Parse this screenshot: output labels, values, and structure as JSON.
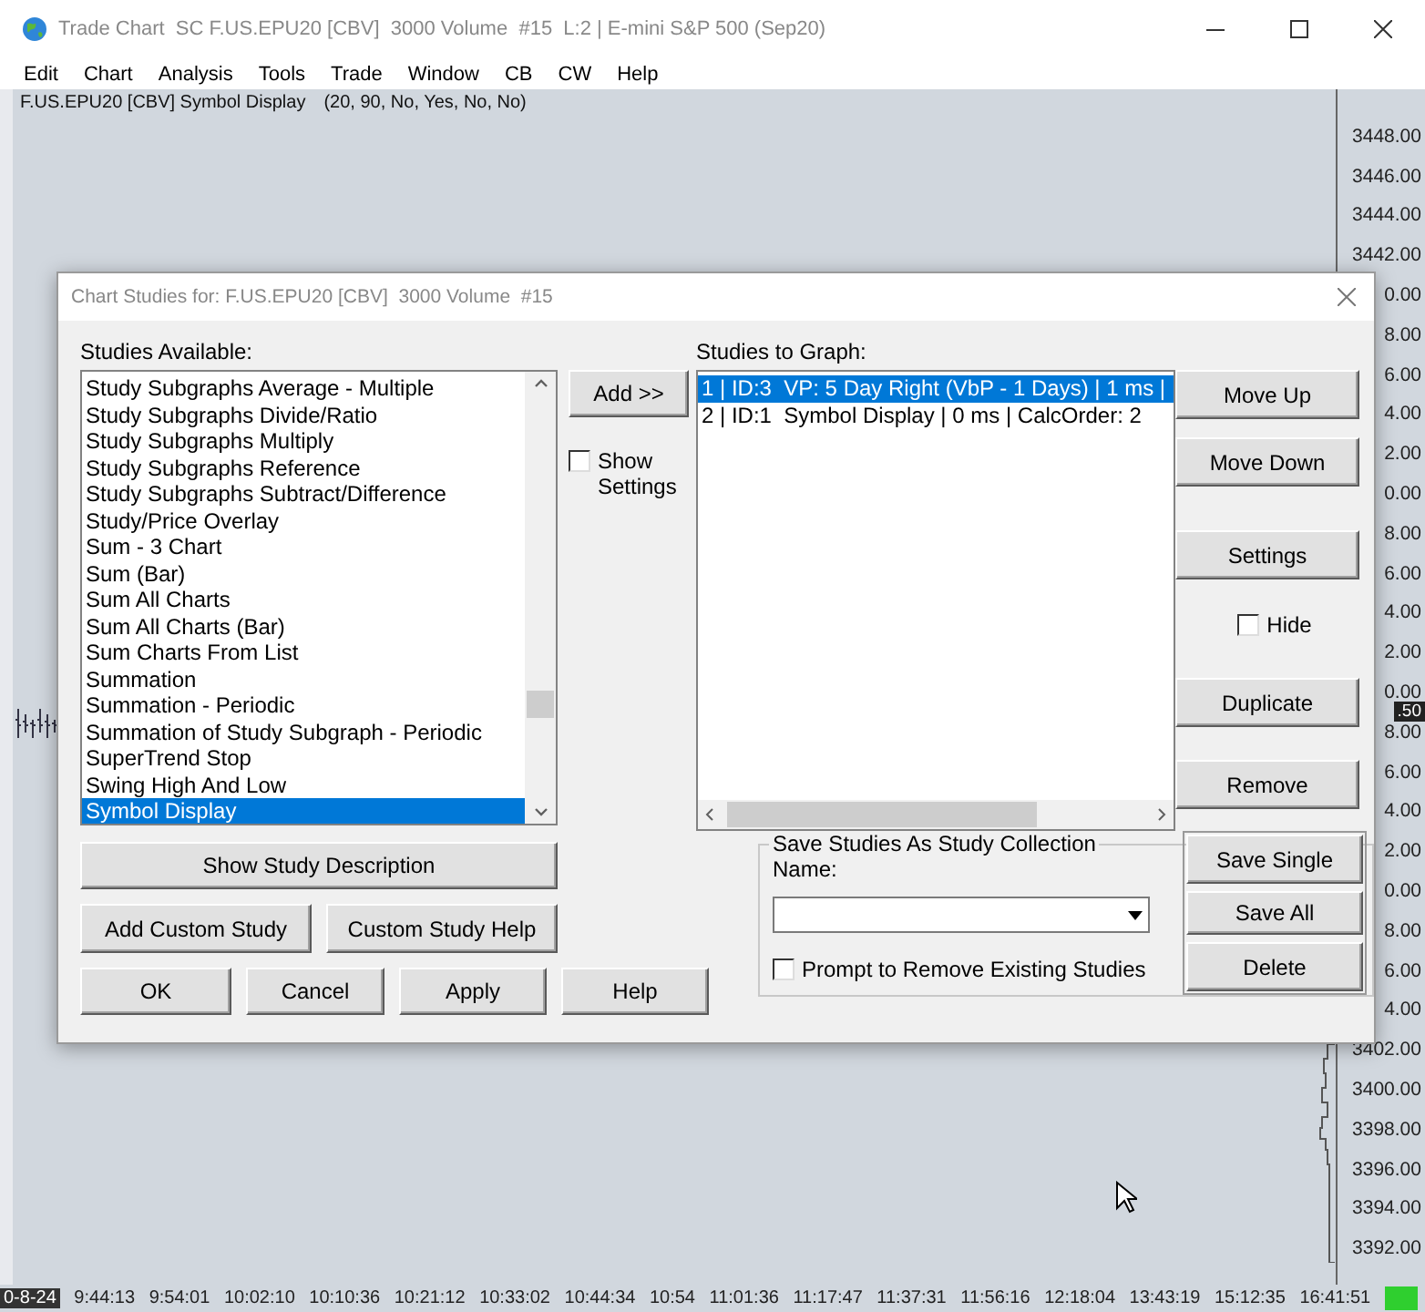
{
  "window": {
    "title": "Trade Chart  SC F.US.EPU20 [CBV]  3000 Volume  #15  L:2 | E-mini S&P 500 (Sep20)"
  },
  "menu": [
    "Edit",
    "Chart",
    "Analysis",
    "Tools",
    "Trade",
    "Window",
    "CB",
    "CW",
    "Help"
  ],
  "chart": {
    "study_label": "F.US.EPU20 [CBV] Symbol Display",
    "study_params": "(20, 90, No, Yes, No, No)",
    "price_labels": [
      "3448.00",
      "3446.00",
      "3444.00",
      "3442.00",
      "0.00",
      "8.00",
      "6.00",
      "4.00",
      "2.00",
      "0.00",
      "8.00",
      "6.00",
      "4.00",
      "2.00",
      "0.00",
      "8.00",
      "6.00",
      "4.00",
      "2.00",
      "0.00",
      "8.00",
      "6.00",
      "4.00",
      "3402.00",
      "3400.00",
      "3398.00",
      "3396.00",
      "3394.00",
      "3392.00"
    ],
    "current_price": ".50",
    "date_label": "0-8-24",
    "time_labels": [
      "9:44:13",
      "9:54:01",
      "10:02:10",
      "10:10:36",
      "10:21:12",
      "10:33:02",
      "10:44:34",
      "10:54",
      "11:01:36",
      "11:17:47",
      "11:37:31",
      "11:56:16",
      "12:18:04",
      "13:43:19",
      "15:12:35",
      "16:41:51"
    ]
  },
  "dialog": {
    "title": "Chart Studies for: F.US.EPU20 [CBV]  3000 Volume  #15",
    "available_label": "Studies Available:",
    "available": [
      {
        "label": "Study Subgraphs Average - Multiple",
        "selected": false
      },
      {
        "label": "Study Subgraphs Divide/Ratio",
        "selected": false
      },
      {
        "label": "Study Subgraphs Multiply",
        "selected": false
      },
      {
        "label": "Study Subgraphs Reference",
        "selected": false
      },
      {
        "label": "Study Subgraphs Subtract/Difference",
        "selected": false
      },
      {
        "label": "Study/Price Overlay",
        "selected": false
      },
      {
        "label": "Sum - 3 Chart",
        "selected": false
      },
      {
        "label": "Sum (Bar)",
        "selected": false
      },
      {
        "label": "Sum All Charts",
        "selected": false
      },
      {
        "label": "Sum All Charts (Bar)",
        "selected": false
      },
      {
        "label": "Sum Charts From List",
        "selected": false
      },
      {
        "label": "Summation",
        "selected": false
      },
      {
        "label": "Summation - Periodic",
        "selected": false
      },
      {
        "label": "Summation of Study Subgraph - Periodic",
        "selected": false
      },
      {
        "label": "SuperTrend Stop",
        "selected": false
      },
      {
        "label": "Swing High And Low",
        "selected": false
      },
      {
        "label": "Symbol Display",
        "selected": true
      }
    ],
    "add_button": "Add >>",
    "show_settings": {
      "label": "Show Settings",
      "checked": false
    },
    "graph_label": "Studies to Graph:",
    "graph": [
      {
        "label": "1 | ID:3  VP: 5 Day Right (VbP - 1 Days) | 1 ms |",
        "selected": true
      },
      {
        "label": "2 | ID:1  Symbol Display | 0 ms | CalcOrder: 2",
        "selected": false
      }
    ],
    "side_buttons": [
      "Move Up",
      "Move Down",
      "Settings",
      "Duplicate",
      "Remove"
    ],
    "hide": {
      "label": "Hide",
      "checked": false
    },
    "describe_button": "Show Study Description",
    "custom_buttons": [
      "Add Custom Study",
      "Custom Study Help"
    ],
    "footer_buttons": [
      "OK",
      "Cancel",
      "Apply",
      "Help"
    ],
    "collection": {
      "title": "Save Studies As Study Collection",
      "name_label": "Name:",
      "prompt": {
        "label": "Prompt to Remove Existing Studies",
        "checked": false
      },
      "buttons": [
        "Save Single",
        "Save All",
        "Delete"
      ]
    }
  }
}
